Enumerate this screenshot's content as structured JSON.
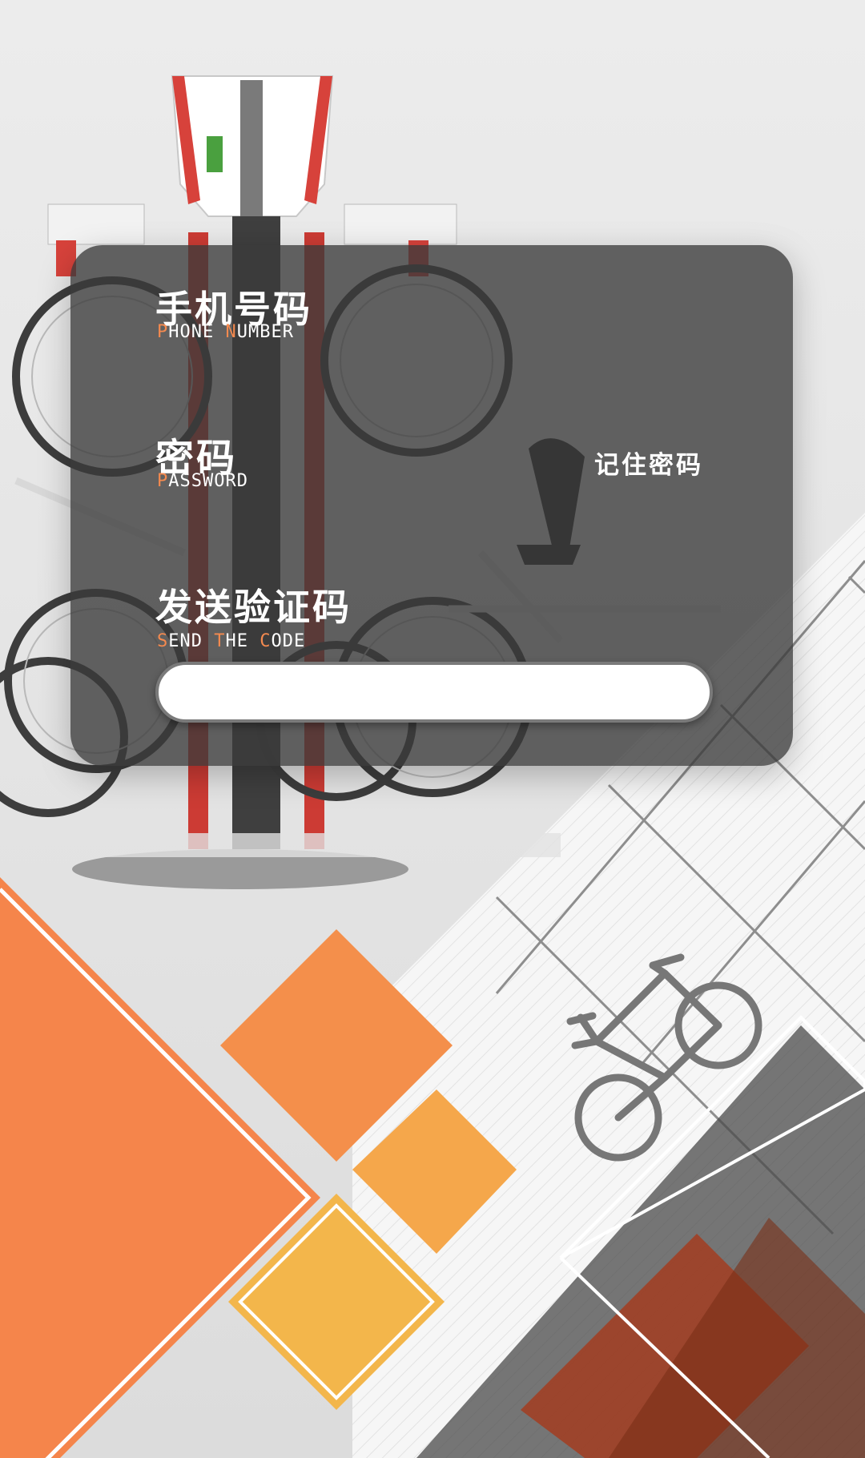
{
  "form": {
    "phone": {
      "label_cn": "手机号码",
      "label_en_first": "P",
      "label_en_mid": "HONE ",
      "label_en_second": "N",
      "label_en_rest": "UMBER"
    },
    "password": {
      "label_cn": "密码",
      "label_en_first": "P",
      "label_en_rest": "ASSWORD"
    },
    "code": {
      "label_cn": "发送验证码",
      "w1_first": "S",
      "w1_rest": "END ",
      "w2_first": "T",
      "w2_rest": "HE ",
      "w3_first": "C",
      "w3_rest": "ODE",
      "input_value": ""
    },
    "remember_password": "记住密码"
  },
  "colors": {
    "accent_orange": "#f58a4f",
    "card_background": "#3a3a3a",
    "diamond_orange": "#f5854b",
    "diamond_yellow": "#f3b64b"
  },
  "icons": [
    "bicycle-icon"
  ]
}
